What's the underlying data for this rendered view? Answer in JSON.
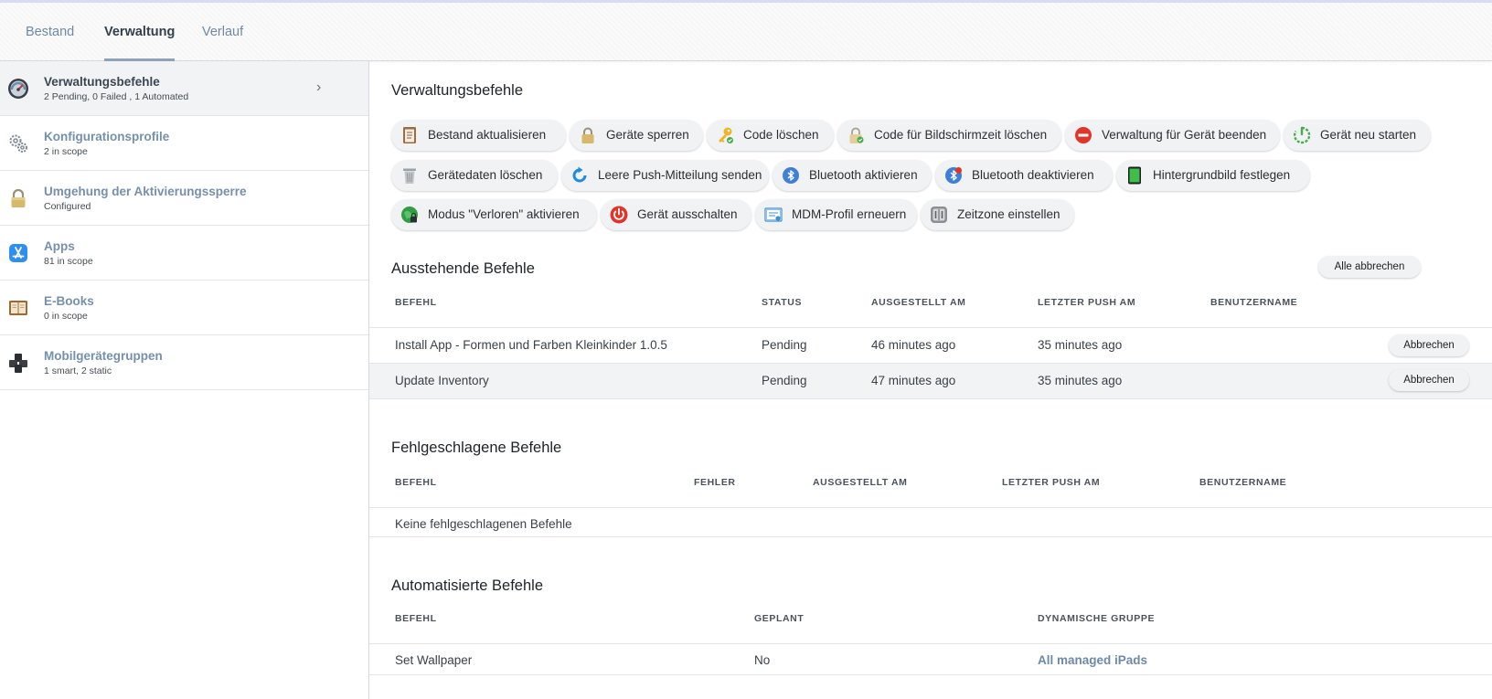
{
  "tabs": [
    {
      "label": "Bestand"
    },
    {
      "label": "Verwaltung"
    },
    {
      "label": "Verlauf"
    }
  ],
  "sidebar": {
    "items": [
      {
        "title": "Verwaltungsbefehle",
        "subtitle": "2 Pending, 0 Failed , 1 Automated",
        "icon": "gauge-icon"
      },
      {
        "title": "Konfigurationsprofile",
        "subtitle": "2 in scope",
        "icon": "gears-icon"
      },
      {
        "title": "Umgehung der Aktivierungssperre",
        "subtitle": "Configured",
        "icon": "padlock-icon"
      },
      {
        "title": "Apps",
        "subtitle": "81 in scope",
        "icon": "app-store-icon"
      },
      {
        "title": "E-Books",
        "subtitle": "0 in scope",
        "icon": "book-icon"
      },
      {
        "title": "Mobilgerätegruppen",
        "subtitle": "1 smart, 2 static",
        "icon": "device-group-icon"
      }
    ]
  },
  "commands_section": {
    "title": "Verwaltungsbefehle",
    "buttons": [
      {
        "label": "Bestand aktualisieren",
        "icon": "clipboard-icon"
      },
      {
        "label": "Geräte sperren",
        "icon": "lock-icon"
      },
      {
        "label": "Code löschen",
        "icon": "key-icon"
      },
      {
        "label": "Code für Bildschirmzeit löschen",
        "icon": "screen-time-lock-icon"
      },
      {
        "label": "Verwaltung für Gerät beenden",
        "icon": "stop-icon"
      },
      {
        "label": "Gerät neu starten",
        "icon": "restart-icon"
      },
      {
        "label": "Gerätedaten löschen",
        "icon": "trash-icon"
      },
      {
        "label": "Leere Push-Mitteilung senden",
        "icon": "refresh-icon"
      },
      {
        "label": "Bluetooth aktivieren",
        "icon": "bluetooth-icon"
      },
      {
        "label": "Bluetooth deaktivieren",
        "icon": "bluetooth-off-icon"
      },
      {
        "label": "Hintergrundbild festlegen",
        "icon": "ipad-icon"
      },
      {
        "label": "Modus \"Verloren\" aktivieren",
        "icon": "lost-mode-icon"
      },
      {
        "label": "Gerät ausschalten",
        "icon": "power-icon"
      },
      {
        "label": "MDM-Profil erneuern",
        "icon": "certificate-icon"
      },
      {
        "label": "Zeitzone einstellen",
        "icon": "timezone-icon"
      }
    ]
  },
  "pending": {
    "title": "Ausstehende Befehle",
    "cancel_all": "Alle abbrechen",
    "columns": [
      "BEFEHL",
      "STATUS",
      "AUSGESTELLT AM",
      "LETZTER PUSH AM",
      "BENUTZERNAME"
    ],
    "rows": [
      {
        "command": "Install App - Formen und Farben Kleinkinder 1.0.5",
        "status": "Pending",
        "issued": "46 minutes ago",
        "last_push": "35 minutes ago",
        "username": "",
        "action": "Abbrechen"
      },
      {
        "command": "Update Inventory",
        "status": "Pending",
        "issued": "47 minutes ago",
        "last_push": "35 minutes ago",
        "username": "",
        "action": "Abbrechen"
      }
    ]
  },
  "failed": {
    "title": "Fehlgeschlagene Befehle",
    "columns": [
      "BEFEHL",
      "FEHLER",
      "AUSGESTELLT AM",
      "LETZTER PUSH AM",
      "BENUTZERNAME"
    ],
    "empty_text": "Keine fehlgeschlagenen Befehle"
  },
  "automated": {
    "title": "Automatisierte Befehle",
    "columns": [
      "BEFEHL",
      "GEPLANT",
      "DYNAMISCHE GRUPPE"
    ],
    "rows": [
      {
        "command": "Set Wallpaper",
        "scheduled": "No",
        "group": "All managed iPads"
      }
    ]
  },
  "colors": {
    "link": "#6c8aa8",
    "active_tab_underline": "#8fa2b8",
    "button_bg": "#f1f2f4"
  }
}
